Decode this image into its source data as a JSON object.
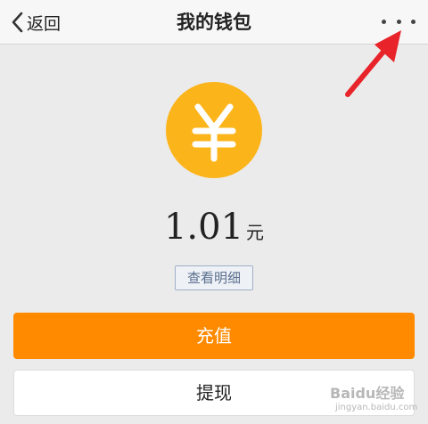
{
  "navbar": {
    "back_label": "返回",
    "title": "我的钱包",
    "more_icon": "more-dots-icon",
    "back_icon": "chevron-left-icon"
  },
  "wallet": {
    "coin_icon": "yuan-coin-icon",
    "coin_color": "#fcb41b",
    "balance": "1.01",
    "unit": "元",
    "details_label": "查看明细"
  },
  "actions": {
    "recharge_label": "充值",
    "recharge_color": "#ff8a00",
    "withdraw_label": "提现"
  },
  "annotation": {
    "arrow_color": "#e8232a",
    "watermark": "Baidu经验",
    "watermark_sub": "jingyan.baidu.com"
  }
}
